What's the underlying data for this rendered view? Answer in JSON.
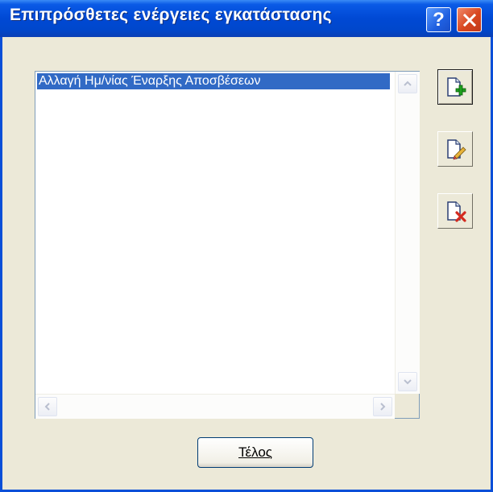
{
  "window": {
    "title": "Επιπρόσθετες ενέργειες εγκατάστασης",
    "help_glyph": "?",
    "close_glyph": "✕"
  },
  "list": {
    "items": [
      {
        "label": "Αλλαγή Ημ/νίας Έναρξης Αποσβέσεων",
        "selected": true
      }
    ]
  },
  "toolbar": {
    "buttons": [
      {
        "icon": "new-document-add-icon"
      },
      {
        "icon": "edit-document-icon"
      },
      {
        "icon": "delete-document-icon"
      }
    ]
  },
  "footer": {
    "done_label": "Τέλος"
  },
  "colors": {
    "titlebar": "#0049d4",
    "selection": "#316ac5",
    "window_bg": "#ece9d8"
  }
}
